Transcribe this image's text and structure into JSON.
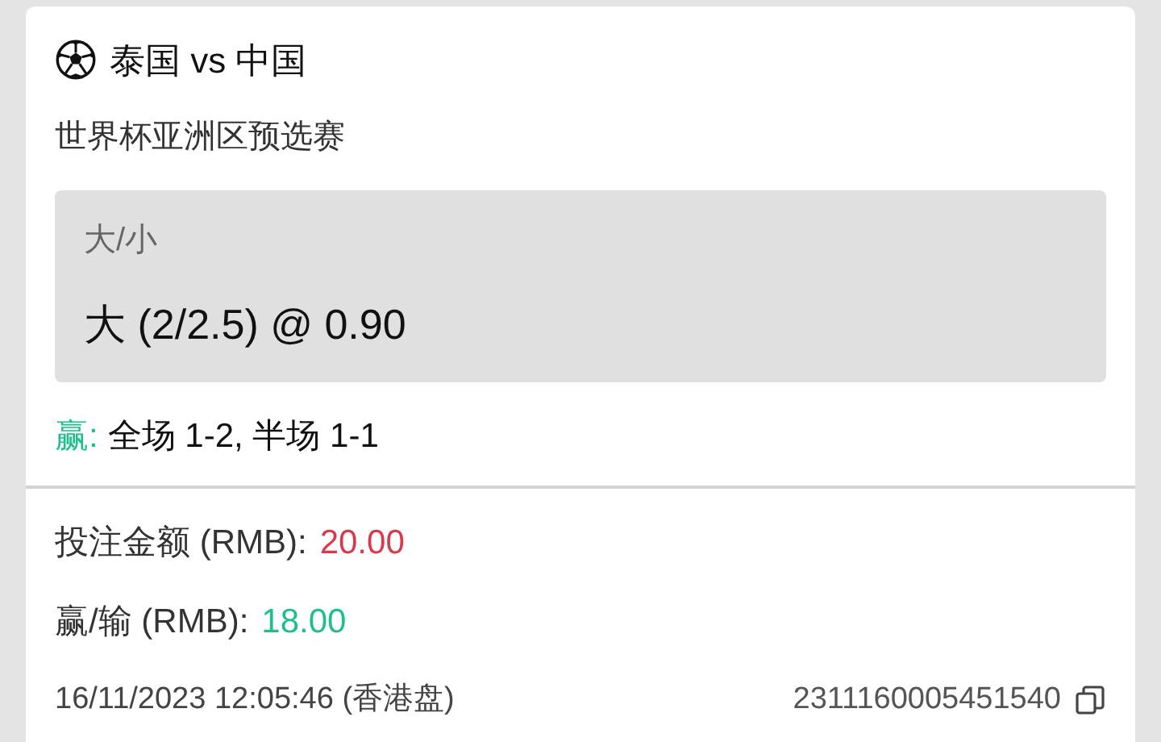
{
  "match": {
    "title": "泰国 vs 中国",
    "league": "世界杯亚洲区预选赛"
  },
  "bet": {
    "market": "大/小",
    "selection": "大 (2/2.5) @ 0.90"
  },
  "result": {
    "label": "赢:",
    "text": "全场 1-2, 半场 1-1"
  },
  "stake": {
    "label": "投注金额 (RMB):",
    "value": "20.00"
  },
  "win_loss": {
    "label": "赢/输 (RMB):",
    "value": "18.00"
  },
  "footer": {
    "datetime": "16/11/2023 12:05:46 (香港盘)",
    "ticket_id": "2311160005451540"
  }
}
